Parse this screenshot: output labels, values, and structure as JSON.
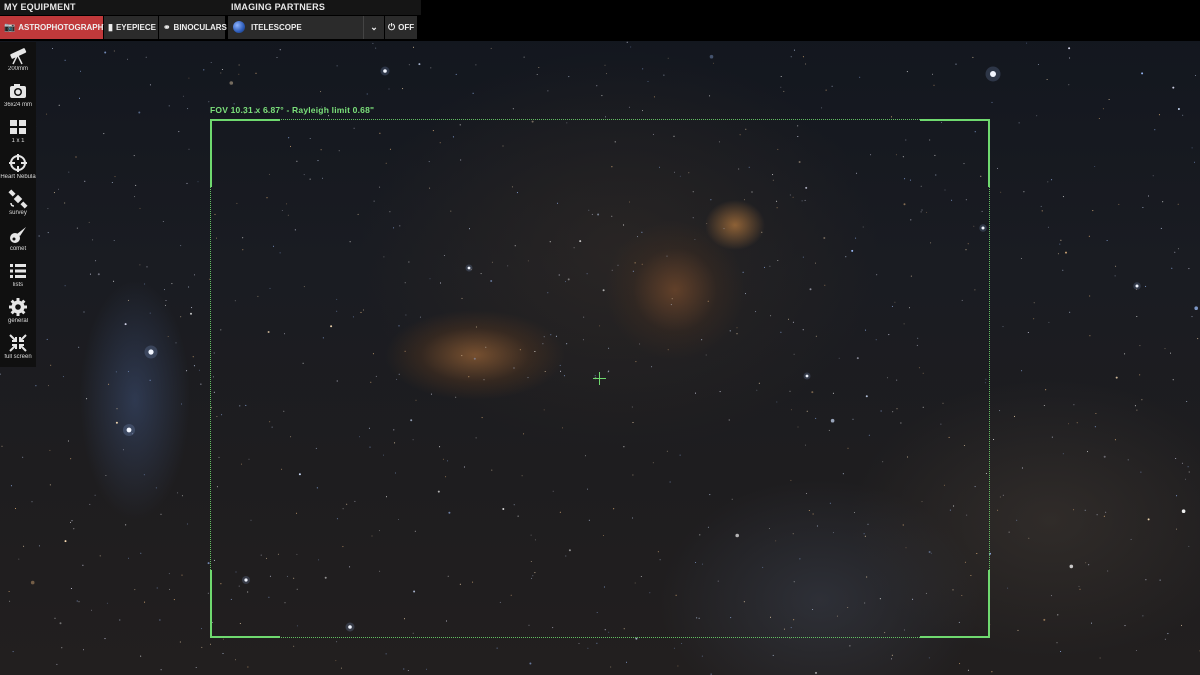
{
  "equipment": {
    "title": "MY EQUIPMENT",
    "tabs": [
      {
        "label": "ASTROPHOTOGRAPHY",
        "icon": "camera-icon",
        "active": true
      },
      {
        "label": "EYEPIECE",
        "icon": "eyepiece-icon",
        "active": false
      },
      {
        "label": "BINOCULARS",
        "icon": "binoculars-icon",
        "active": false
      }
    ]
  },
  "partners": {
    "title": "IMAGING PARTNERS",
    "selected": "ITELESCOPE",
    "off_label": "OFF"
  },
  "sidebar": {
    "items": [
      {
        "label": "200mm",
        "icon": "telescope-icon"
      },
      {
        "label": "36x24 mm",
        "icon": "camera-icon"
      },
      {
        "label": "1 x 1",
        "icon": "mosaic-grid-icon"
      },
      {
        "label": "Heart Nebula",
        "icon": "target-crosshair-icon"
      },
      {
        "label": "survey",
        "icon": "satellite-icon"
      },
      {
        "label": "comet",
        "icon": "comet-icon"
      },
      {
        "label": "lists",
        "icon": "list-icon"
      },
      {
        "label": "general",
        "icon": "gear-icon"
      },
      {
        "label": "full screen",
        "icon": "fullscreen-icon"
      }
    ]
  },
  "fov": {
    "label": "FOV 10.31 x 6.87° - Rayleigh limit 0.68\""
  },
  "colors": {
    "accent_active": "#c0393b",
    "fov_green": "#6fd96f"
  }
}
